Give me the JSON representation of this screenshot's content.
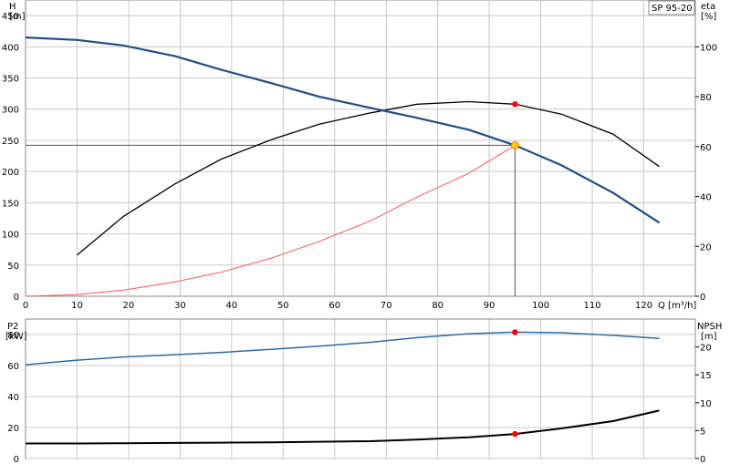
{
  "colors": {
    "grid": "#c8c8c8",
    "frame": "#888888",
    "head_curve": "#1f4e8c",
    "efficiency_curve": "#000000",
    "system_curve": "#ff5555",
    "power_curve": "#2a6aa8",
    "npsh_curve": "#000000",
    "duty_point": "#ff0000",
    "duty_marker_fill": "#ffcc00"
  },
  "chart_data": [
    {
      "type": "line",
      "legend_box": "SP 95-20",
      "xlabel": "Q [m³/h]",
      "ylabel_left": [
        "H",
        "[m]"
      ],
      "ylabel_right": [
        "eta",
        "[%]"
      ],
      "xlim": [
        0,
        130
      ],
      "ylim": [
        0,
        475
      ],
      "ylim_right": [
        0,
        118.75
      ],
      "x_ticks": [
        "0",
        "10",
        "20",
        "30",
        "40",
        "50",
        "60",
        "70",
        "80",
        "90",
        "100",
        "110",
        "120"
      ],
      "y_ticks": [
        "0",
        "50",
        "100",
        "150",
        "200",
        "250",
        "300",
        "350",
        "400",
        "450"
      ],
      "y_right_ticks": [
        "0",
        "20",
        "40",
        "60",
        "80",
        "100"
      ],
      "grid": true,
      "series": [
        {
          "key": "head",
          "axis": "left",
          "x": [
            0,
            10,
            19,
            29,
            38,
            48,
            57,
            67,
            76,
            86,
            95,
            104,
            114,
            123
          ],
          "y": [
            415,
            411,
            402,
            385,
            363,
            341,
            320,
            302,
            286,
            267,
            242,
            210,
            166,
            118
          ]
        },
        {
          "key": "efficiency",
          "axis": "right",
          "x": [
            10,
            19,
            29,
            38,
            48,
            57,
            67,
            76,
            86,
            95,
            104,
            114,
            123
          ],
          "y": [
            16.5,
            32,
            45,
            55,
            63,
            69,
            73.5,
            77,
            78,
            77,
            73,
            65,
            52
          ]
        },
        {
          "key": "system",
          "axis": "left",
          "x": [
            0,
            10,
            19,
            29,
            38,
            48,
            57,
            67,
            76,
            86,
            95
          ],
          "y": [
            0,
            2.7,
            10,
            23,
            38.8,
            62,
            88,
            121,
            159,
            197,
            242
          ]
        }
      ],
      "duty_point": {
        "x": 95,
        "y_head": 242,
        "y_efficiency": 77
      }
    },
    {
      "type": "line",
      "ylabel_left": [
        "P2",
        "[kW]"
      ],
      "ylabel_right": [
        "NPSH",
        "[m]"
      ],
      "xlim": [
        0,
        130
      ],
      "ylim": [
        0,
        90
      ],
      "ylim_right": [
        0,
        25
      ],
      "y_ticks": [
        "0",
        "20",
        "40",
        "60",
        "80"
      ],
      "y_right_ticks": [
        "0",
        "5",
        "10",
        "15",
        "20"
      ],
      "grid": true,
      "series": [
        {
          "key": "power",
          "axis": "left",
          "x": [
            0,
            10,
            19,
            29,
            38,
            48,
            57,
            67,
            76,
            86,
            95,
            104,
            114,
            123
          ],
          "y": [
            60.5,
            63.5,
            65.5,
            67,
            68.5,
            70.5,
            72.5,
            75,
            78,
            80.5,
            81.5,
            81.2,
            79.5,
            77.5
          ]
        },
        {
          "key": "npsh",
          "axis": "right",
          "x": [
            0,
            10,
            19,
            29,
            38,
            48,
            57,
            67,
            76,
            86,
            95,
            104,
            114,
            123
          ],
          "y": [
            2.7,
            2.7,
            2.75,
            2.8,
            2.85,
            2.9,
            3.0,
            3.1,
            3.4,
            3.8,
            4.4,
            5.4,
            6.7,
            8.6
          ]
        }
      ],
      "duty_point": {
        "x": 95,
        "y_power": 81.5,
        "y_npsh": 4.4
      }
    }
  ]
}
